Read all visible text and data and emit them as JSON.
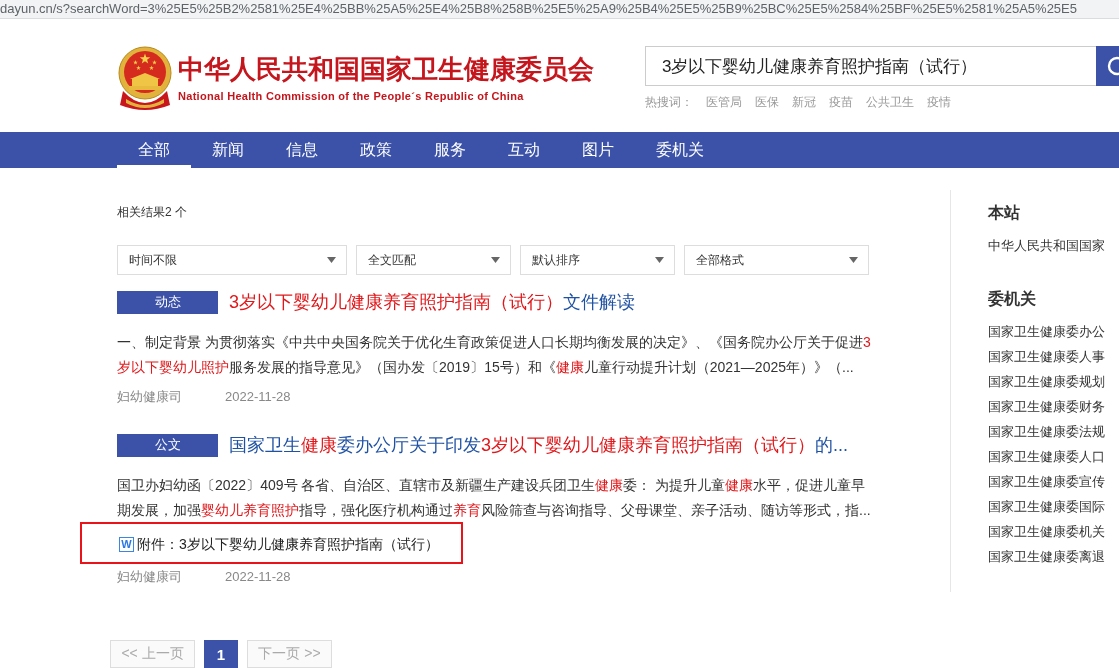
{
  "browser": {
    "url": "dayun.cn/s?searchWord=3%25E5%25B2%2581%25E4%25BB%25A5%25E4%25B8%258B%25E5%25A9%25B4%25E5%25B9%25BC%25E5%2584%25BF%25E5%2581%25A5%25E5"
  },
  "header": {
    "title": "中华人民共和国国家卫生健康委员会",
    "subtitle": "National Health Commission of the People´s Republic of China",
    "search": {
      "value": "3岁以下婴幼儿健康养育照护指南（试行）"
    },
    "hot_words": {
      "label": "热搜词：",
      "items": [
        "医管局",
        "医保",
        "新冠",
        "疫苗",
        "公共卫生",
        "疫情"
      ]
    }
  },
  "nav": {
    "tabs": [
      {
        "label": "全部",
        "selected": true
      },
      {
        "label": "新闻",
        "selected": false
      },
      {
        "label": "信息",
        "selected": false
      },
      {
        "label": "政策",
        "selected": false
      },
      {
        "label": "服务",
        "selected": false
      },
      {
        "label": "互动",
        "selected": false
      },
      {
        "label": "图片",
        "selected": false
      },
      {
        "label": "委机关",
        "selected": false
      }
    ]
  },
  "results": {
    "count": "相关结果2 个",
    "filters": [
      "时间不限",
      "全文匹配",
      "默认排序",
      "全部格式"
    ],
    "items": [
      {
        "tag": "动态",
        "title": [
          {
            "text": "3岁以下婴幼儿健康养育照护指南（试行）",
            "highlight": true
          },
          {
            "text": "文件解读",
            "highlight": false
          }
        ],
        "snippet": [
          {
            "text": "一、制定背景 为贯彻落实《中共中央国务院关于优化生育政策促进人口长期均衡发展的决定》、《国务院办公厅关于促进",
            "highlight": false
          },
          {
            "text": "3岁以下婴幼儿照护",
            "highlight": true
          },
          {
            "text": "服务发展的指导意见》（国办发〔2019〕15号）和《",
            "highlight": false
          },
          {
            "text": "健康",
            "highlight": true
          },
          {
            "text": "儿童行动提升计划（2021—2025年）》（...",
            "highlight": false
          }
        ],
        "source": "妇幼健康司",
        "date": "2022-11-28"
      },
      {
        "tag": "公文",
        "title": [
          {
            "text": "国家卫生",
            "highlight": false
          },
          {
            "text": "健康",
            "highlight": true
          },
          {
            "text": "委办公厅关于印发",
            "highlight": false
          },
          {
            "text": "3岁以下婴幼儿健康养育照护指南（试行）",
            "highlight": true
          },
          {
            "text": "的...",
            "highlight": false
          }
        ],
        "snippet": [
          {
            "text": "国卫办妇幼函〔2022〕409号 各省、自治区、直辖市及新疆生产建设兵团卫生",
            "highlight": false
          },
          {
            "text": "健康",
            "highlight": true
          },
          {
            "text": "委： 为提升儿童",
            "highlight": false
          },
          {
            "text": "健康",
            "highlight": true
          },
          {
            "text": "水平，促进儿童早期发展，加强",
            "highlight": false
          },
          {
            "text": "婴幼儿养育照护",
            "highlight": true
          },
          {
            "text": "指导，强化医疗机构通过",
            "highlight": false
          },
          {
            "text": "养育",
            "highlight": true
          },
          {
            "text": "风险筛查与咨询指导、父母课堂、亲子活动、随访等形式，指...",
            "highlight": false
          }
        ],
        "attachment": {
          "icon": "W",
          "label": "附件：3岁以下婴幼儿健康养育照护指南（试行）",
          "highlighted": true
        },
        "source": "妇幼健康司",
        "date": "2022-11-28"
      }
    ]
  },
  "pagination": {
    "previous": {
      "label": "<< 上一页",
      "disabled": true
    },
    "pages": [
      {
        "label": "1",
        "selected": true
      }
    ],
    "next": {
      "label": "下一页 >>",
      "disabled": true
    }
  },
  "sidebar": {
    "sections": [
      {
        "title": "本站",
        "items": [
          "中华人民共和国国家"
        ]
      },
      {
        "title": "委机关",
        "items": [
          "国家卫生健康委办公",
          "国家卫生健康委人事",
          "国家卫生健康委规划",
          "国家卫生健康委财务",
          "国家卫生健康委法规",
          "国家卫生健康委人口",
          "国家卫生健康委宣传",
          "国家卫生健康委国际",
          "国家卫生健康委机关",
          "国家卫生健康委离退"
        ]
      }
    ]
  }
}
